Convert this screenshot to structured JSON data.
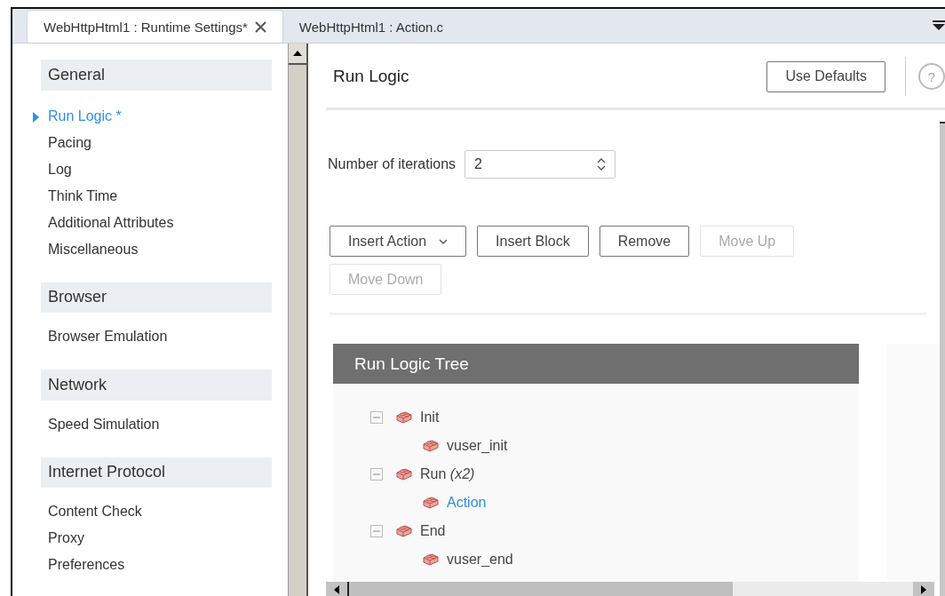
{
  "tabs": [
    {
      "label": "WebHttpHtml1 : Runtime Settings*",
      "selected": true,
      "closable": true
    },
    {
      "label": "WebHttpHtml1 : Action.c",
      "selected": false,
      "closable": false
    }
  ],
  "sidebar": {
    "sections": [
      {
        "title": "General",
        "items": [
          {
            "label": "Run Logic *",
            "selected": true
          },
          {
            "label": "Pacing",
            "selected": false
          },
          {
            "label": "Log",
            "selected": false
          },
          {
            "label": "Think Time",
            "selected": false
          },
          {
            "label": "Additional Attributes",
            "selected": false
          },
          {
            "label": "Miscellaneous",
            "selected": false
          }
        ]
      },
      {
        "title": "Browser",
        "items": [
          {
            "label": "Browser Emulation",
            "selected": false
          }
        ]
      },
      {
        "title": "Network",
        "items": [
          {
            "label": "Speed Simulation",
            "selected": false
          }
        ]
      },
      {
        "title": "Internet Protocol",
        "items": [
          {
            "label": "Content Check",
            "selected": false
          },
          {
            "label": "Proxy",
            "selected": false
          },
          {
            "label": "Preferences",
            "selected": false
          }
        ]
      }
    ]
  },
  "panel": {
    "title": "Run Logic",
    "use_defaults": "Use Defaults",
    "help": "?",
    "iterations": {
      "label": "Number of iterations",
      "value": "2"
    },
    "buttons": [
      {
        "label": "Insert Action",
        "disabled": false,
        "dropdown": true
      },
      {
        "label": "Insert Block",
        "disabled": false,
        "dropdown": false
      },
      {
        "label": "Remove",
        "disabled": false,
        "dropdown": false
      },
      {
        "label": "Move Up",
        "disabled": true,
        "dropdown": false
      },
      {
        "label": "Move Down",
        "disabled": true,
        "dropdown": false
      }
    ],
    "tree": {
      "title": "Run Logic Tree",
      "nodes": [
        {
          "label": "Init",
          "expanded": true,
          "selected": false,
          "children": [
            {
              "label": "vuser_init",
              "selected": false
            }
          ]
        },
        {
          "label": "Run *(x2)*",
          "expanded": true,
          "selected": false,
          "children": [
            {
              "label": "Action",
              "selected": true
            }
          ]
        },
        {
          "label": "End",
          "expanded": true,
          "selected": false,
          "children": [
            {
              "label": "vuser_end",
              "selected": false
            }
          ]
        }
      ]
    }
  }
}
